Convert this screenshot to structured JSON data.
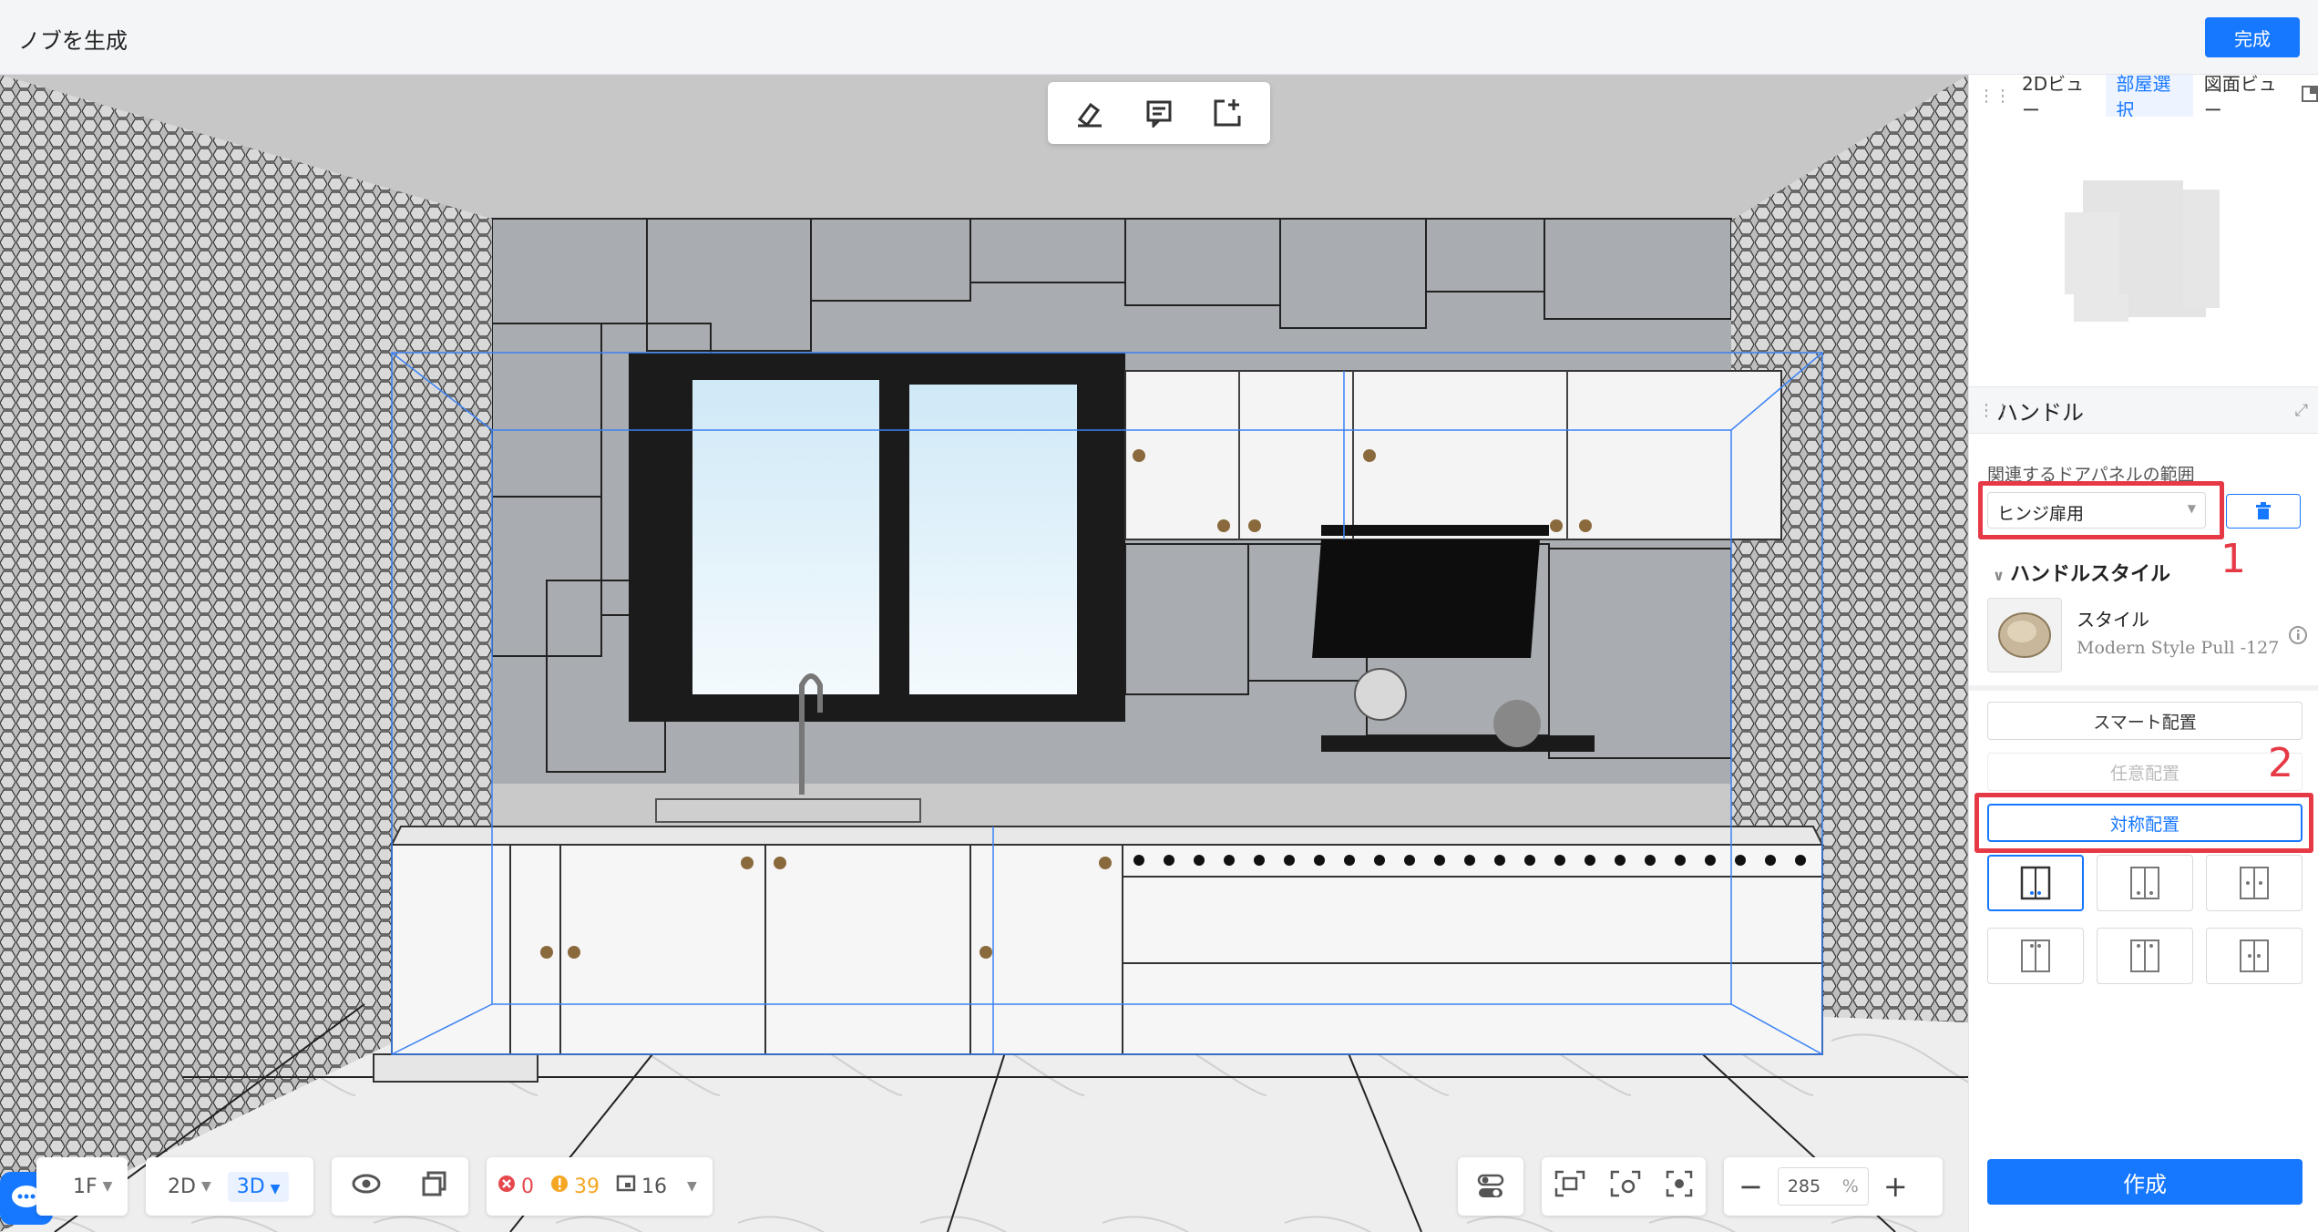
{
  "header": {
    "title": "ノブを生成",
    "done_label": "完成"
  },
  "bottom_bar": {
    "floor": "1F",
    "view_2d": "2D",
    "view_3d": "3D",
    "errors": "0",
    "warnings": "39",
    "rooms": "16",
    "zoom_value": "285",
    "zoom_unit": "%"
  },
  "side_panel": {
    "tabs": [
      "2Dビュー",
      "部屋選択",
      "図面ビュー"
    ],
    "active_tab": "部屋選択",
    "section_title": "ハンドル",
    "door_panel_label": "関連するドアパネルの範囲",
    "door_panel_value": "ヒンジ扉用",
    "handle_style_header": "ハンドルスタイル",
    "style_label": "スタイル",
    "style_model": "Modern Style Pull -127",
    "smart_placement": "スマート配置",
    "free_placement": "任意配置",
    "symmetric_placement": "対称配置",
    "create_label": "作成"
  },
  "annotations": {
    "marker_1": "1",
    "marker_2": "2"
  },
  "colors": {
    "accent": "#1677ff",
    "highlight_red": "#e63946"
  }
}
